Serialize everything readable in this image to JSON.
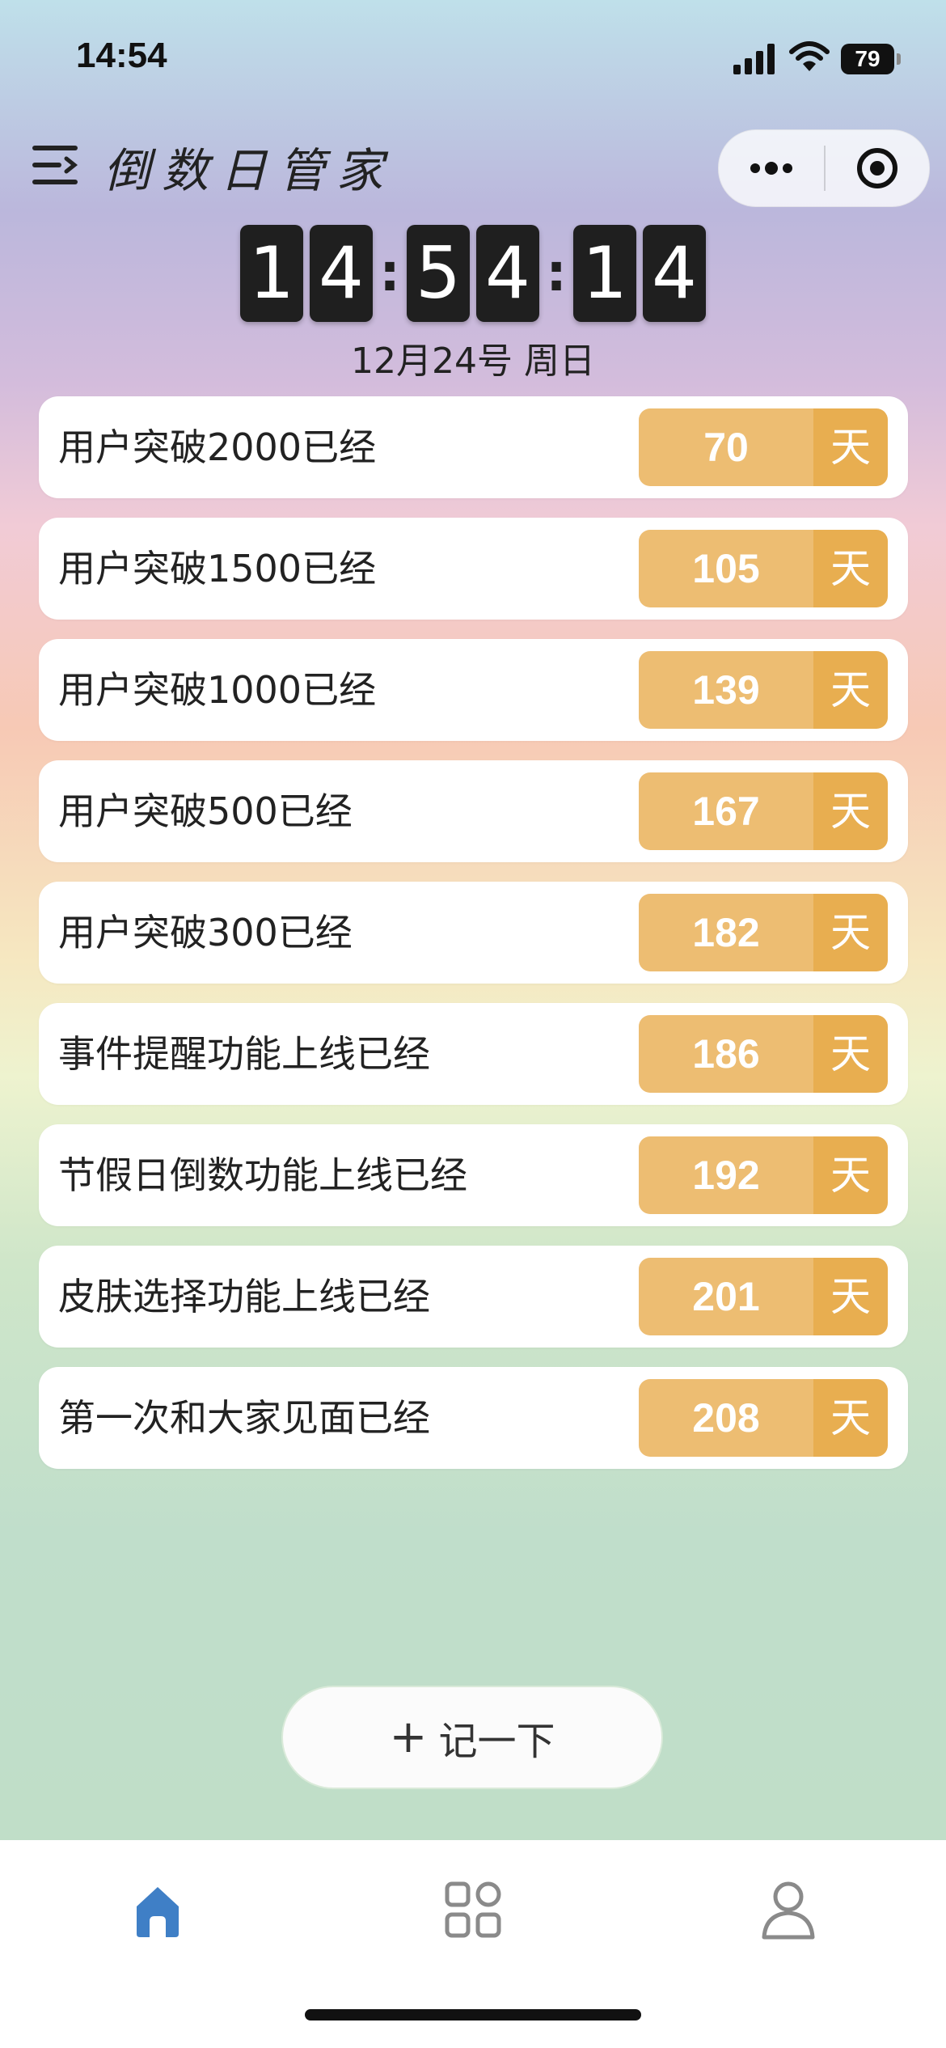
{
  "status_bar": {
    "time": "14:54",
    "battery": "79"
  },
  "header": {
    "title": "倒数日管家"
  },
  "clock": {
    "digits": [
      "1",
      "4",
      "5",
      "4",
      "1",
      "4"
    ],
    "separator": ":",
    "date": "12月24号 周日"
  },
  "events": [
    {
      "label": "用户突破2000已经",
      "days": "70",
      "unit": "天"
    },
    {
      "label": "用户突破1500已经",
      "days": "105",
      "unit": "天"
    },
    {
      "label": "用户突破1000已经",
      "days": "139",
      "unit": "天"
    },
    {
      "label": "用户突破500已经",
      "days": "167",
      "unit": "天"
    },
    {
      "label": "用户突破300已经",
      "days": "182",
      "unit": "天"
    },
    {
      "label": "事件提醒功能上线已经",
      "days": "186",
      "unit": "天"
    },
    {
      "label": "节假日倒数功能上线已经",
      "days": "192",
      "unit": "天"
    },
    {
      "label": "皮肤选择功能上线已经",
      "days": "201",
      "unit": "天"
    },
    {
      "label": "第一次和大家见面已经",
      "days": "208",
      "unit": "天"
    }
  ],
  "add_button": {
    "icon": "+",
    "label": "记一下"
  },
  "tabbar": {
    "items": [
      {
        "icon": "home-icon",
        "active": true
      },
      {
        "icon": "grid-icon",
        "active": false
      },
      {
        "icon": "user-icon",
        "active": false
      }
    ],
    "active_color": "#3f7fc6",
    "inactive_color": "#8a8a8a"
  },
  "colors": {
    "badge_count": "#edbd72",
    "badge_unit": "#e8ae50"
  }
}
